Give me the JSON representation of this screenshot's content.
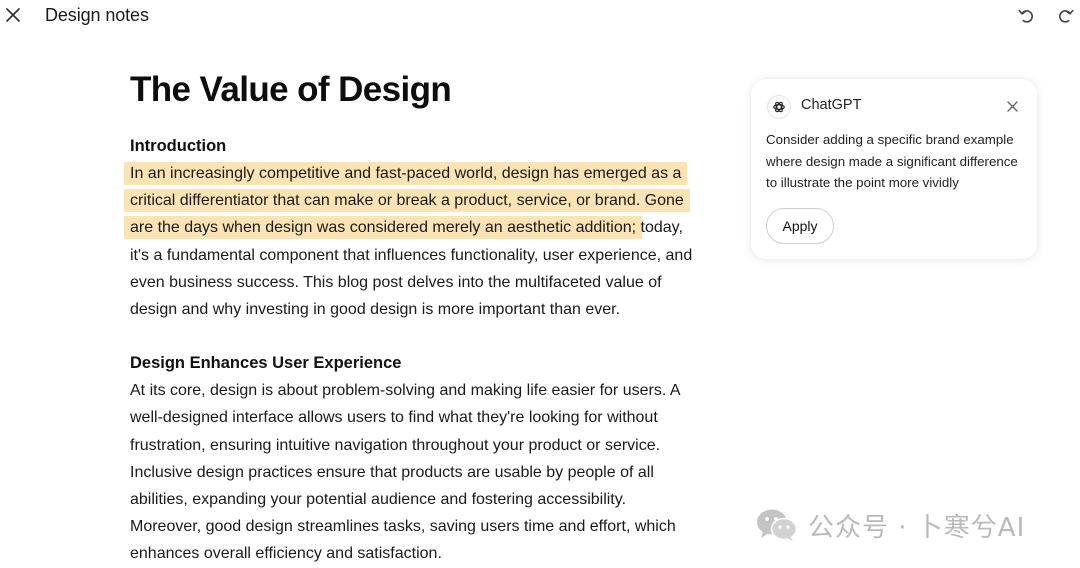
{
  "topbar": {
    "document_name": "Design notes",
    "close_icon": "close-icon",
    "undo_icon": "undo-icon",
    "redo_icon": "redo-icon"
  },
  "document": {
    "title": "The Value of Design",
    "intro": {
      "heading": "Introduction",
      "highlighted_text": "In an increasingly competitive and fast-paced world, design has emerged as a critical differentiator that can make or break a product, service, or brand. Gone are the days when design was considered merely an aesthetic addition;",
      "rest_text": " today, it's a fundamental component that influences functionality, user experience, and even business success. This blog post delves into the multifaceted value of design and why investing in good design is more important than ever."
    },
    "ux": {
      "heading": "Design Enhances User Experience",
      "text": "At its core, design is about problem-solving and making life easier for users. A well-designed interface allows users to find what they're looking for without frustration, ensuring intuitive navigation throughout your product or service. Inclusive design practices ensure that products are usable by people of all abilities, expanding your potential audience and fostering accessibility. Moreover, good design streamlines tasks, saving users time and effort, which enhances overall efficiency and satisfaction."
    },
    "highlight_color": "#fbe3b3"
  },
  "suggestion": {
    "assistant_name": "ChatGPT",
    "logo_icon": "chatgpt-logo-icon",
    "message": "Consider adding a specific brand example where design made a significant difference to illustrate the point more vividly",
    "apply_label": "Apply"
  },
  "watermark": {
    "icon": "wechat-icon",
    "text": "公众号 · 卜寒兮AI"
  }
}
